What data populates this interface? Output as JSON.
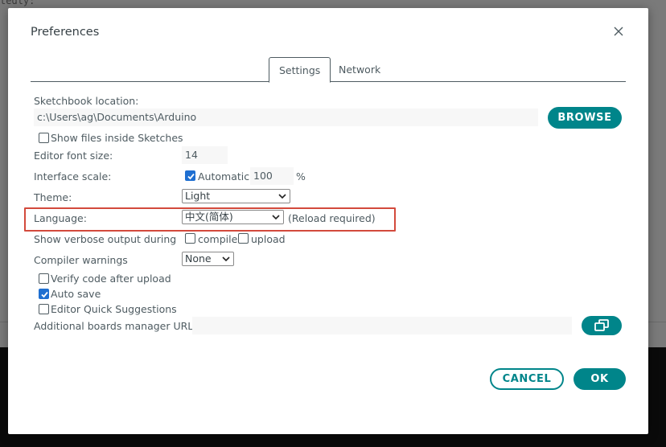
{
  "background": {
    "code_text": "tedly:"
  },
  "dialog": {
    "title": "Preferences",
    "tabs": [
      {
        "label": "Settings",
        "active": true
      },
      {
        "label": "Network",
        "active": false
      }
    ],
    "sketchbook": {
      "label": "Sketchbook location:",
      "value": "c:\\Users\\ag\\Documents\\Arduino",
      "browse_label": "BROWSE"
    },
    "show_files": {
      "label": "Show files inside Sketches",
      "checked": false
    },
    "font_size": {
      "label": "Editor font size:",
      "value": "14"
    },
    "interface_scale": {
      "label": "Interface scale:",
      "automatic_label": "Automatic",
      "automatic_checked": true,
      "value": "100",
      "unit": "%"
    },
    "theme": {
      "label": "Theme:",
      "value": "Light"
    },
    "language": {
      "label": "Language:",
      "value": "中文(简体)",
      "note": "(Reload required)"
    },
    "verbose": {
      "label": "Show verbose output during",
      "compile_label": "compile",
      "compile_checked": false,
      "upload_label": "upload",
      "upload_checked": false
    },
    "compiler_warnings": {
      "label": "Compiler warnings",
      "value": "None"
    },
    "verify": {
      "label": "Verify code after upload",
      "checked": false
    },
    "auto_save": {
      "label": "Auto save",
      "checked": true
    },
    "quick_suggestions": {
      "label": "Editor Quick Suggestions",
      "checked": false
    },
    "boards_urls": {
      "label": "Additional boards manager URLs:",
      "value": ""
    },
    "cancel_label": "CANCEL",
    "ok_label": "OK"
  },
  "colors": {
    "accent": "#00858a",
    "highlight": "#d34a3c",
    "checkbox": "#1f6fd1"
  },
  "icons": {
    "close": "close-icon",
    "open_window": "open-window-icon",
    "chevron": "chevron-down-icon"
  }
}
